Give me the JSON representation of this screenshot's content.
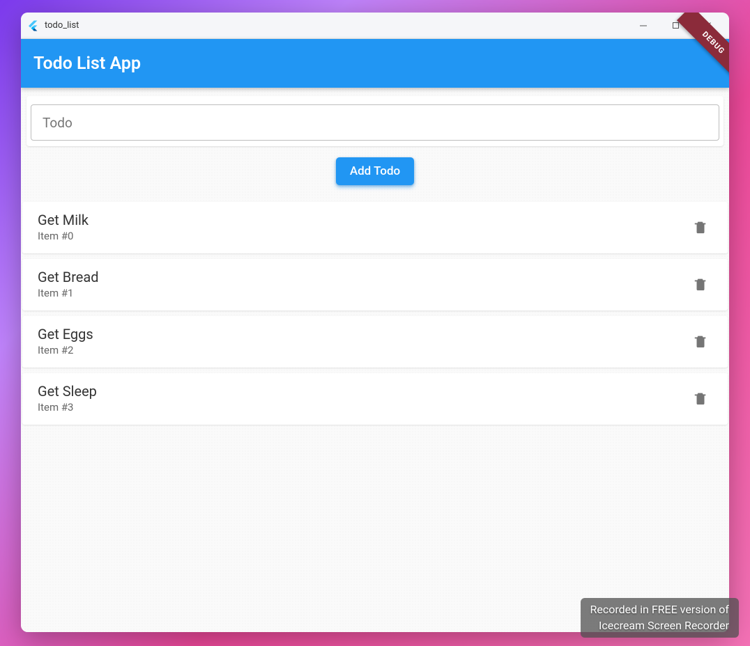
{
  "window": {
    "title": "todo_list"
  },
  "appbar": {
    "title": "Todo List App",
    "debug_banner": "DEBUG"
  },
  "input": {
    "placeholder": "Todo",
    "value": ""
  },
  "add_button": {
    "label": "Add Todo"
  },
  "todos": [
    {
      "title": "Get Milk",
      "subtitle": "Item #0"
    },
    {
      "title": "Get Bread",
      "subtitle": "Item #1"
    },
    {
      "title": "Get Eggs",
      "subtitle": "Item #2"
    },
    {
      "title": "Get Sleep",
      "subtitle": "Item #3"
    }
  ],
  "watermark": {
    "line1": "Recorded in FREE version of",
    "line2": "Icecream Screen Recorder"
  }
}
